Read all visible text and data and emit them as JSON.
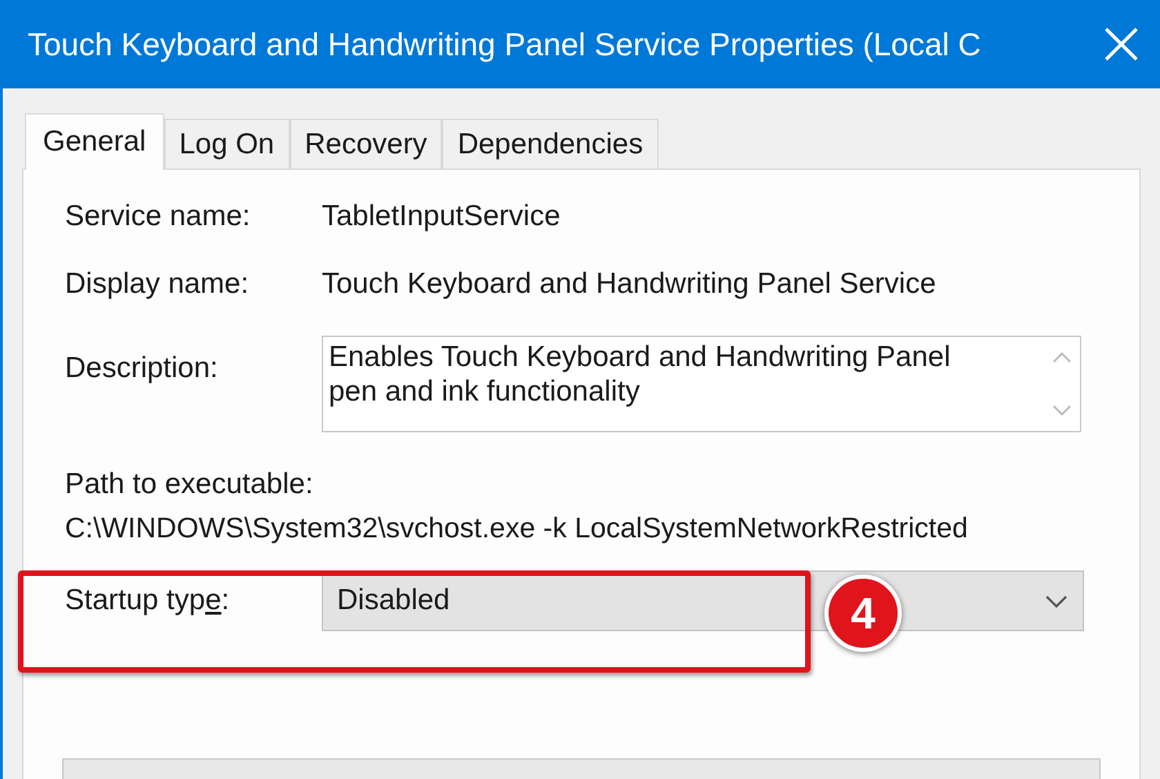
{
  "window": {
    "title": "Touch Keyboard and Handwriting Panel Service Properties (Local C"
  },
  "tabs": [
    {
      "label": "General",
      "selected": true
    },
    {
      "label": "Log On",
      "selected": false
    },
    {
      "label": "Recovery",
      "selected": false
    },
    {
      "label": "Dependencies",
      "selected": false
    }
  ],
  "fields": [
    {
      "label": "Service name:",
      "value": "TabletInputService"
    },
    {
      "label": "Display name:",
      "value": "Touch Keyboard and Handwriting Panel Service"
    }
  ],
  "description": {
    "label": "Description:",
    "value": "Enables Touch Keyboard and Handwriting Panel pen and ink functionality"
  },
  "path": {
    "label": "Path to executable:",
    "value": "C:\\WINDOWS\\System32\\svchost.exe -k LocalSystemNetworkRestricted"
  },
  "startup_type": {
    "label_before": "Startup typ",
    "access_key": "e",
    "label_after": ":",
    "value": "Disabled"
  },
  "annotation": {
    "badge": "4"
  }
}
